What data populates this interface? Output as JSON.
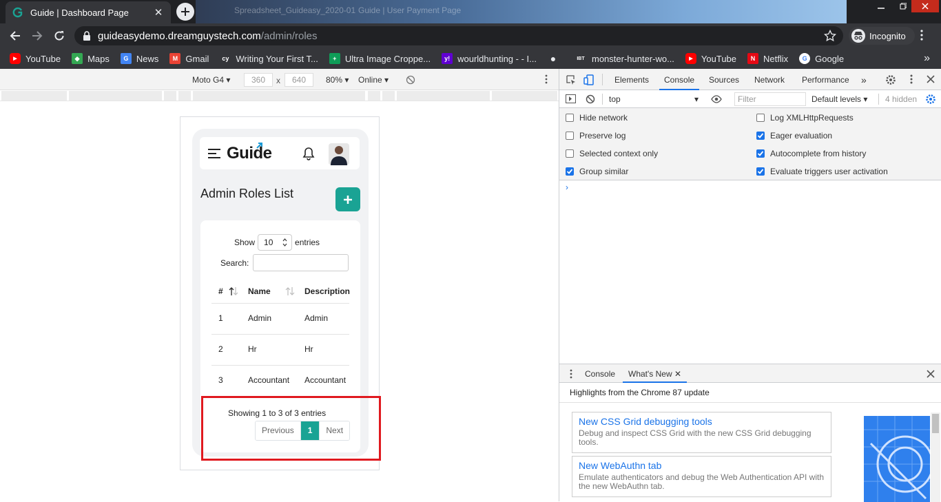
{
  "browser": {
    "tab_title": "Guide | Dashboard Page",
    "url_host": "guideasydemo.dreamguystech.com",
    "url_path": "/admin/roles",
    "incognito_label": "Incognito",
    "bookmarks": [
      {
        "label": "YouTube",
        "icon": "youtube-icon",
        "color": "#ff0000"
      },
      {
        "label": "Maps",
        "icon": "maps-icon",
        "color": "#34a853"
      },
      {
        "label": "News",
        "icon": "news-icon",
        "color": "#4285f4"
      },
      {
        "label": "Gmail",
        "icon": "gmail-icon",
        "color": "#ea4335"
      },
      {
        "label": "Writing Your First T...",
        "icon": "cy-icon",
        "color": "#35363a"
      },
      {
        "label": "Ultra Image Croppe...",
        "icon": "plus-sheet-icon",
        "color": "#0f9d58"
      },
      {
        "label": "wourldhunting - - I...",
        "icon": "yahoo-icon",
        "color": "#6001d2"
      },
      {
        "label": "",
        "icon": "globe-icon",
        "color": "#35363a"
      },
      {
        "label": "monster-hunter-wo...",
        "icon": "ibt-icon",
        "color": "#35363a"
      },
      {
        "label": "YouTube",
        "icon": "youtube-icon",
        "color": "#ff0000"
      },
      {
        "label": "Netflix",
        "icon": "netflix-icon",
        "color": "#e50914"
      },
      {
        "label": "Google",
        "icon": "google-icon",
        "color": "#ffffff"
      }
    ]
  },
  "device_toolbar": {
    "device": "Moto G4",
    "width": "360",
    "times": "x",
    "height": "640",
    "zoom": "80%",
    "network": "Online"
  },
  "page": {
    "logo_text": "Guide",
    "title": "Admin Roles List",
    "add_button": "+",
    "show_label": "Show",
    "entries_value": "10",
    "entries_label": "entries",
    "search_label": "Search:",
    "columns": [
      "#",
      "Name",
      "Description"
    ],
    "rows": [
      [
        "1",
        "Admin",
        "Admin"
      ],
      [
        "2",
        "Hr",
        "Hr"
      ],
      [
        "3",
        "Accountant",
        "Accountant"
      ]
    ],
    "showing_text": "Showing 1 to 3 of 3 entries",
    "pager": {
      "previous": "Previous",
      "current": "1",
      "next": "Next"
    },
    "accent_color": "#1aa394",
    "highlight_color": "#e0191f"
  },
  "devtools": {
    "tabs": [
      "Elements",
      "Console",
      "Sources",
      "Network",
      "Performance"
    ],
    "active_tab": "Console",
    "context": "top",
    "filter_placeholder": "Filter",
    "levels": "Default levels",
    "hidden_count": "4 hidden",
    "options_left": [
      {
        "label": "Hide network",
        "checked": false
      },
      {
        "label": "Preserve log",
        "checked": false
      },
      {
        "label": "Selected context only",
        "checked": false
      },
      {
        "label": "Group similar",
        "checked": true
      }
    ],
    "options_right": [
      {
        "label": "Log XMLHttpRequests",
        "checked": false
      },
      {
        "label": "Eager evaluation",
        "checked": true
      },
      {
        "label": "Autocomplete from history",
        "checked": true
      },
      {
        "label": "Evaluate triggers user activation",
        "checked": true
      }
    ],
    "drawer": {
      "tabs": [
        "Console",
        "What's New"
      ],
      "highlights": "Highlights from the Chrome 87 update",
      "cards": [
        {
          "title": "New CSS Grid debugging tools",
          "desc": "Debug and inspect CSS Grid with the new CSS Grid debugging tools."
        },
        {
          "title": "New WebAuthn tab",
          "desc": "Emulate authenticators and debug the Web Authentication API with the new WebAuthn tab."
        }
      ]
    }
  }
}
